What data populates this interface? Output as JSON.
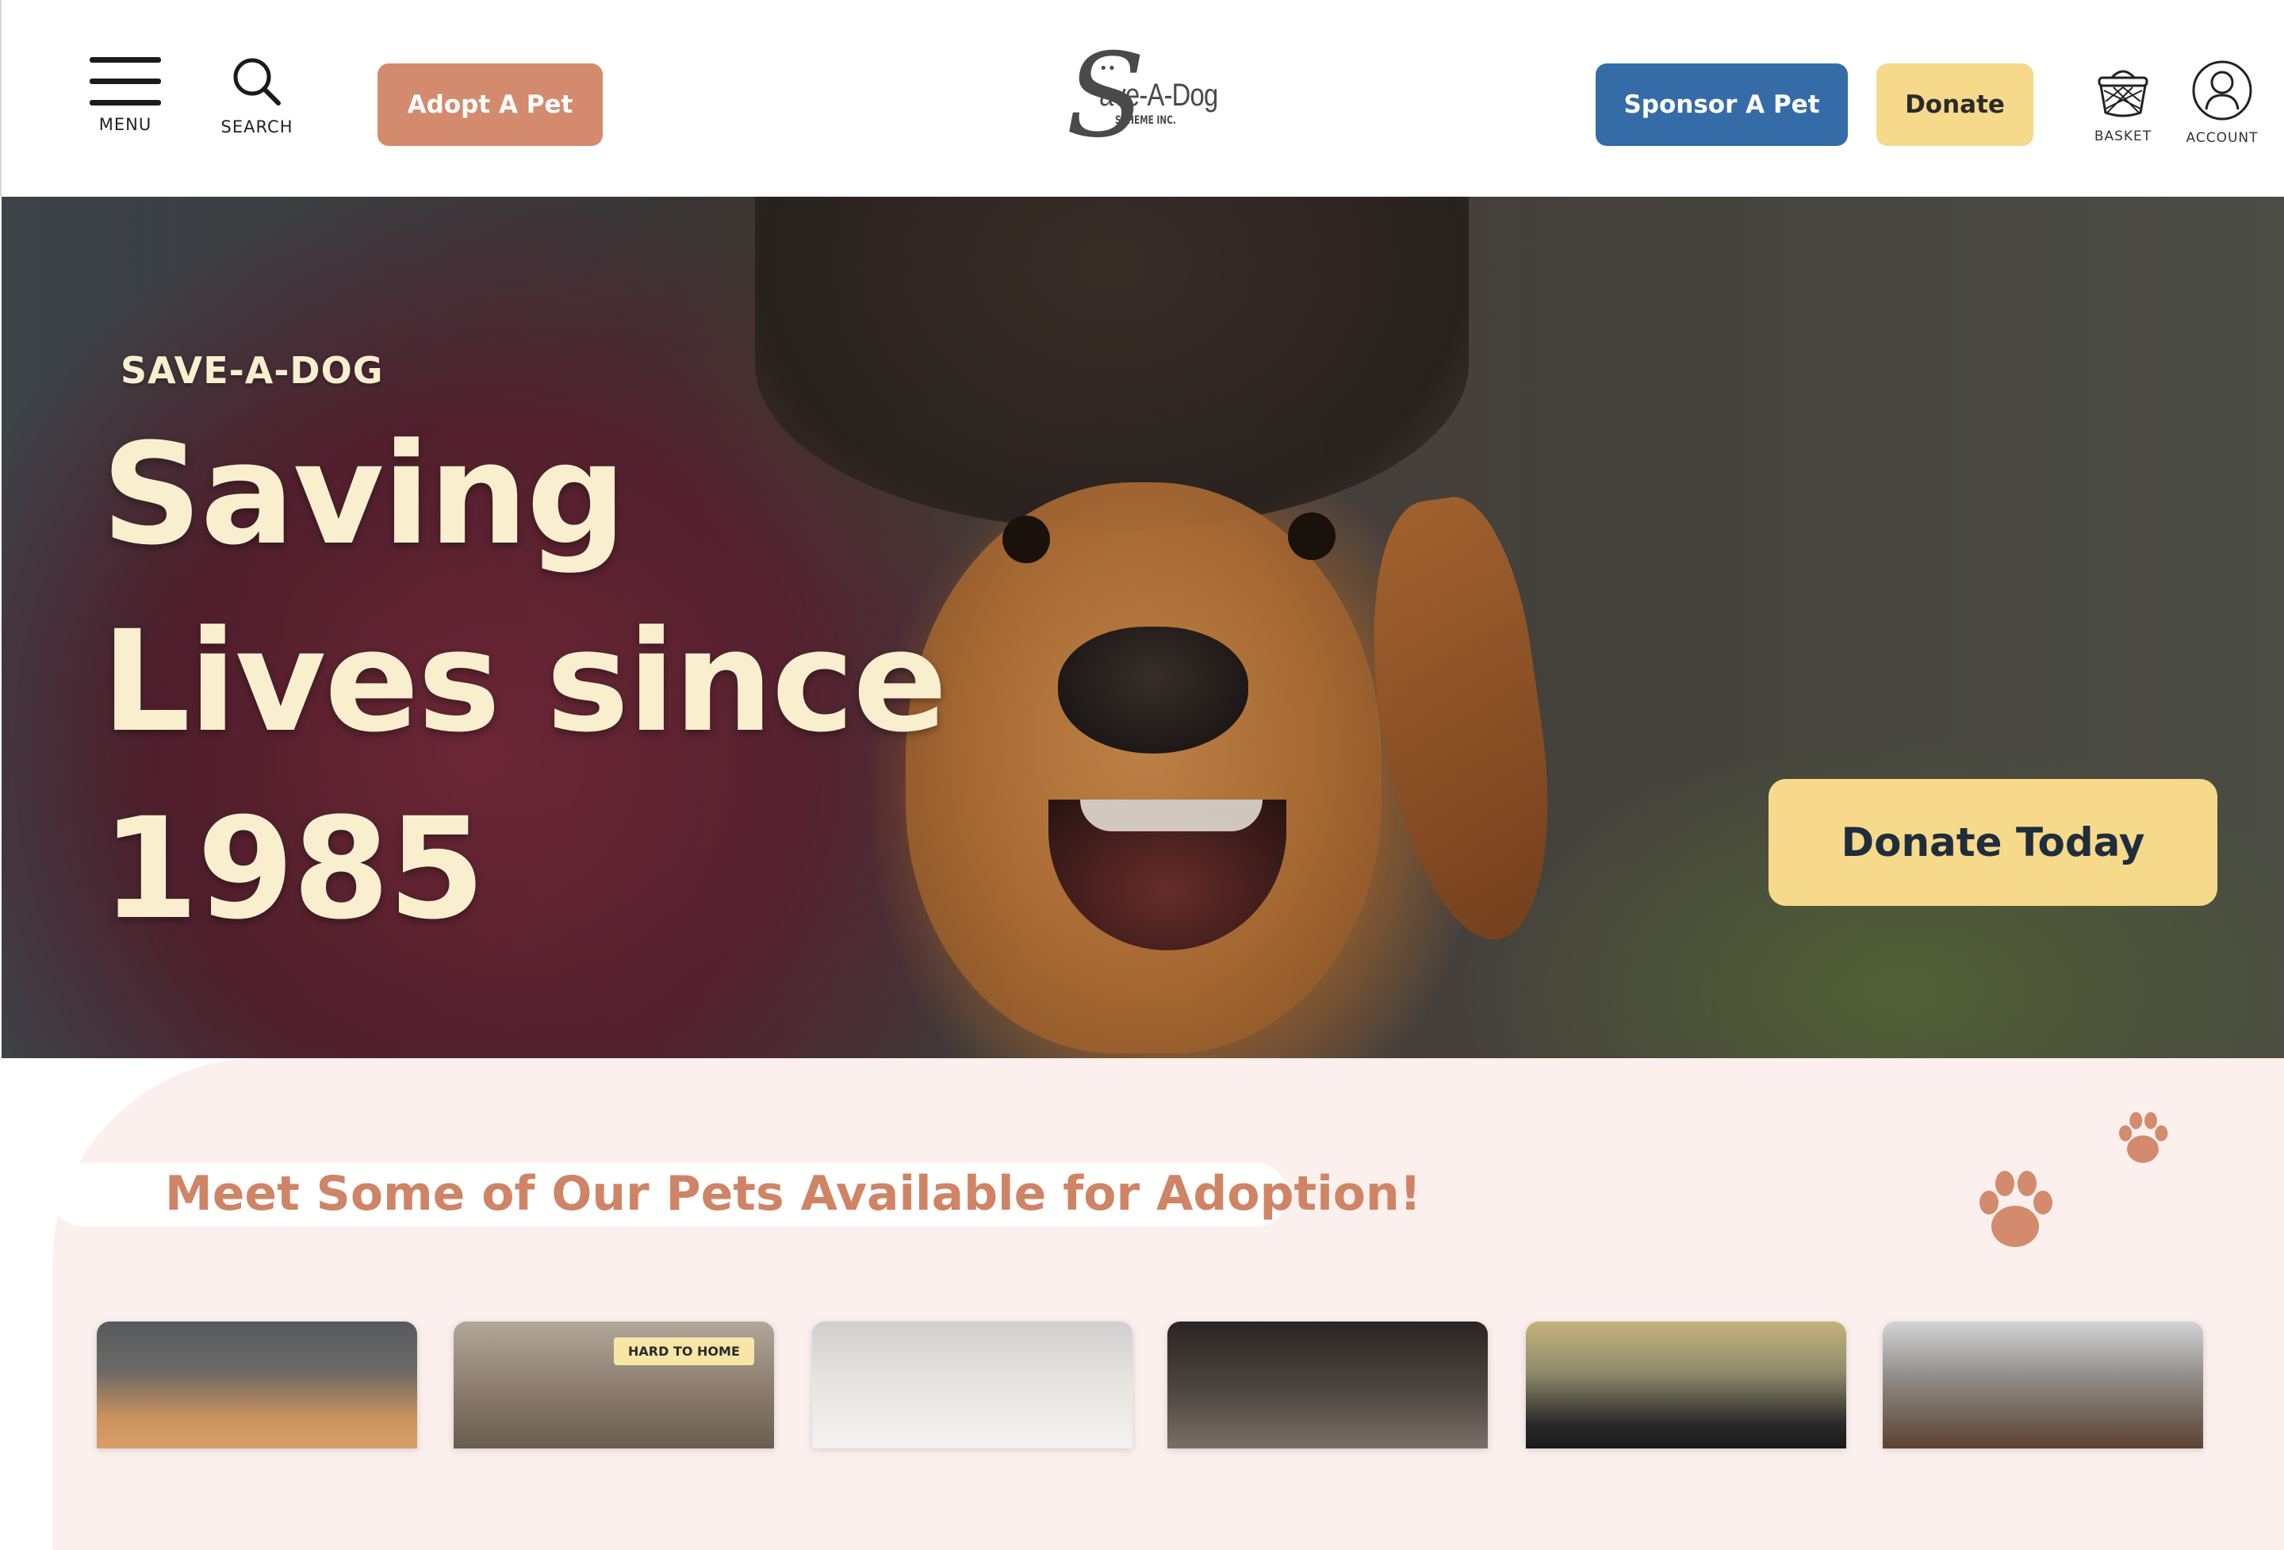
{
  "header": {
    "menu_label": "MENU",
    "search_label": "SEARCH",
    "adopt_button": "Adopt A Pet",
    "logo": {
      "main": "ave-A-Dog",
      "sub": "SCHEME INC."
    },
    "sponsor_button": "Sponsor A Pet",
    "donate_button": "Donate",
    "basket_label": "BASKET",
    "account_label": "ACCOUNT"
  },
  "hero": {
    "kicker": "SAVE-A-DOG",
    "title": "Saving Lives since 1985",
    "cta": "Donate Today"
  },
  "adoption": {
    "heading": "Meet Some of Our Pets Available for Adoption!",
    "cards": [
      {
        "badge": ""
      },
      {
        "badge": "HARD TO HOME"
      },
      {
        "badge": ""
      },
      {
        "badge": ""
      },
      {
        "badge": ""
      },
      {
        "badge": ""
      }
    ]
  },
  "colors": {
    "adopt_button": "#d48a6d",
    "sponsor_button": "#356ca8",
    "donate_button": "#f6d98a",
    "hero_text": "#f9efcf",
    "section_heading": "#cf8466",
    "section_bg": "#fbf0ed"
  },
  "icons": [
    "menu-icon",
    "search-icon",
    "basket-icon",
    "account-icon",
    "paw-print-icon"
  ]
}
